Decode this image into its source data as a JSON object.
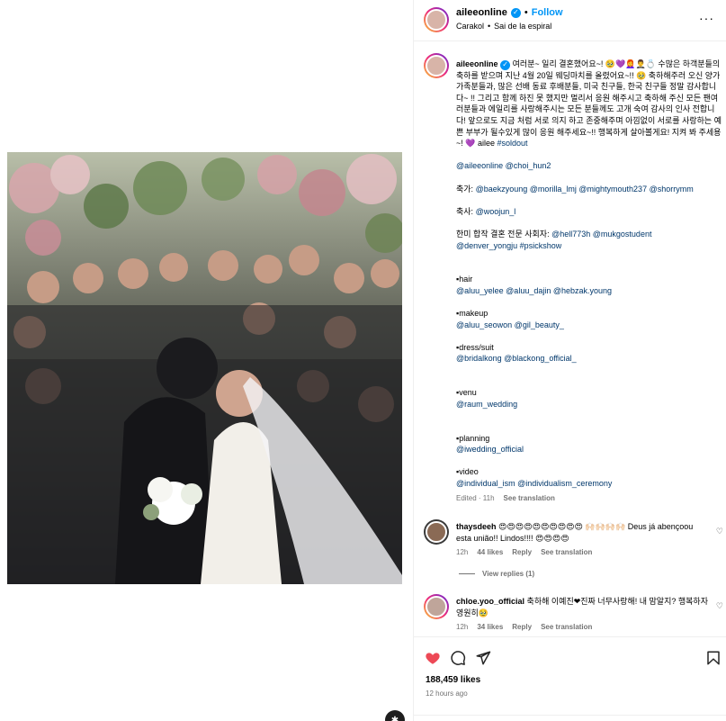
{
  "colors": {
    "accent": "#0095f6",
    "link": "#00376b",
    "like_red": "#ed4956",
    "muted": "#737373"
  },
  "header": {
    "username": "aileeonline",
    "follow_label": "Follow",
    "location_a": "Carakol",
    "location_sep": "•",
    "location_b": "Sai de la espiral",
    "dot": "•"
  },
  "caption": {
    "username": "aileeonline",
    "text": "여러분~ 일리 결혼했어요~! 🥹💜👩‍🦰🤵‍♂️💍 수많은 하객분들의 축하를 받으며 지난 4월 20일 웨딩마치를 올렸어요~!! 🥹 축하해주러 오신 양가 가족분들과, 많은 선배 동료 후배분들, 미국 친구들, 한국 친구들 정말 감사합니다~ !! 그리고 함께 하진 못 했지만 멀리서 응원 해주시고 축하해 주신 모든 팬여러분들과 에일리를 사랑해주시는 모든 분들께도 고개 숙여 감사의 인사 전합니다! 앞으로도 지금 처럼 서로 의지 하고 존중해주며 아낌없이 서로를 사랑하는 예쁜 부부가 될수있게 많이 응원 해주세요~!! 행복하게 살아볼게요! 지켜 봐 주세용~! 💜 ailee",
    "hashtag": "#soldout",
    "mentions_line": "@aileeonline @choi_hun2",
    "chuga_label": "축가:",
    "chuga_links": "@baekzyoung @morilla_lmj @mightymouth237 @shorrymm",
    "chuksa_label": "축사:",
    "chuksa_links": "@woojun_l",
    "host_label": "한미 합작 결혼 전문 사회자:",
    "host_links_1": "@hell773h @mukgostudent",
    "host_links_2": "@denver_yongju #psickshow",
    "hair_label": "▪︎hair",
    "hair_links": "@aluu_yelee @aluu_dajin @hebzak.young",
    "makeup_label": "▪︎makeup",
    "makeup_links": "@aluu_seowon @gil_beauty_",
    "dress_label": "▪︎dress/suit",
    "dress_links": "@bridalkong @blackong_official_",
    "venu_label": "▪︎venu",
    "venu_links": "@raum_wedding",
    "planning_label": "▪︎planning",
    "planning_links": "@iwedding_official",
    "video_label": "▪︎video",
    "video_links": "@individual_ism @individualism_ceremony",
    "edited": "Edited · 11h",
    "see_translation": "See translation"
  },
  "comments": [
    {
      "username": "thaysdeeh",
      "text": "😍😍😍😍😍😍😍😍😍😍 🙌🏻🙌🏻🙌🏻🙌🏻 Deus já abençoou esta união!! Lindos!!!! 😍😍😍😍",
      "time": "12h",
      "likes": "44 likes",
      "reply": "Reply",
      "see_translation": "See translation"
    },
    {
      "username": "chloe.yoo_official",
      "text": "축하해 이예진❤진짜 너무사랑해! 내 맘알지? 행복하자 영원히🥹",
      "time": "12h",
      "likes": "34 likes",
      "reply": "Reply",
      "see_translation": "See translation"
    }
  ],
  "view_replies": "View replies (1)",
  "footer": {
    "likes": "188,459 likes",
    "ago": "12 hours ago"
  },
  "icons": [
    "heart-filled-icon",
    "comment-icon",
    "share-icon",
    "bookmark-icon",
    "verified-icon",
    "reels-badge-icon"
  ]
}
